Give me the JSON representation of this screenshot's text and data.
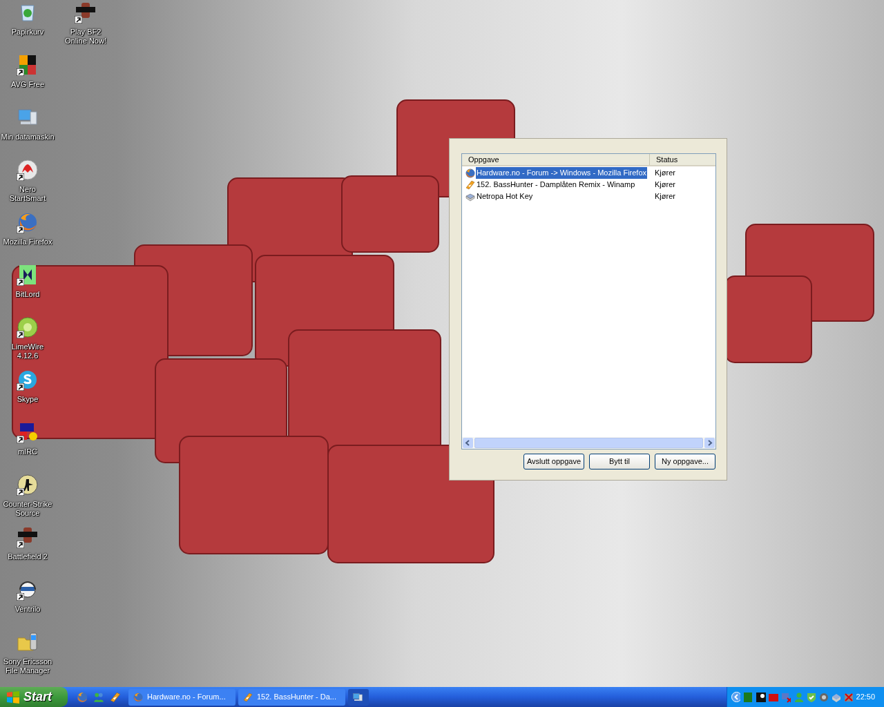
{
  "desktop": {
    "columns": [
      [
        {
          "label": "Papirkurv",
          "kind": "recycle",
          "shortcut": false
        },
        {
          "label": "AVG Free",
          "kind": "avg",
          "shortcut": true
        },
        {
          "label": "Min datamaskin",
          "kind": "computer",
          "shortcut": false
        },
        {
          "label": "Nero StartSmart",
          "kind": "nero",
          "shortcut": true
        },
        {
          "label": "Mozilla Firefox",
          "kind": "firefox",
          "shortcut": true
        },
        {
          "label": "BitLord",
          "kind": "bitlord",
          "shortcut": true
        },
        {
          "label": "LimeWire 4.12.6",
          "kind": "limewire",
          "shortcut": true
        },
        {
          "label": "Skype",
          "kind": "skype",
          "shortcut": true
        },
        {
          "label": "mIRC",
          "kind": "mirc",
          "shortcut": true
        },
        {
          "label": "Counter-Strike Source",
          "kind": "soldier",
          "shortcut": true
        },
        {
          "label": "Battlefield 2",
          "kind": "battlefield",
          "shortcut": true
        },
        {
          "label": "Ventrilo",
          "kind": "headset",
          "shortcut": true
        },
        {
          "label": "Sony Ericsson File Manager",
          "kind": "phone",
          "shortcut": false
        }
      ],
      [
        {
          "label": "Play BF2 Online Now!",
          "kind": "battlefield",
          "shortcut": true
        }
      ]
    ]
  },
  "task_manager": {
    "columns": [
      "Oppgave",
      "Status"
    ],
    "rows": [
      {
        "task": "Hardware.no - Forum -> Windows - Mozilla Firefox",
        "status": "Kjører",
        "kind": "firefox",
        "selected": true
      },
      {
        "task": "152. BassHunter - Damplåten Remix - Winamp",
        "status": "Kjører",
        "kind": "winamp",
        "selected": false
      },
      {
        "task": "Netropa Hot Key",
        "status": "Kjører",
        "kind": "keyboard",
        "selected": false
      }
    ],
    "buttons": [
      "Avslutt oppgave",
      "Bytt til",
      "Ny oppgave..."
    ]
  },
  "taskbar": {
    "start": "Start",
    "quick_launch": [
      {
        "kind": "firefox"
      },
      {
        "kind": "people"
      },
      {
        "kind": "winamp"
      }
    ],
    "tasks": [
      {
        "label": "Hardware.no - Forum...",
        "kind": "firefox",
        "selected": false
      },
      {
        "label": "152. BassHunter - Da...",
        "kind": "winamp",
        "selected": false
      },
      {
        "kind": "computer",
        "selected": true
      }
    ],
    "clock": "22:50"
  }
}
